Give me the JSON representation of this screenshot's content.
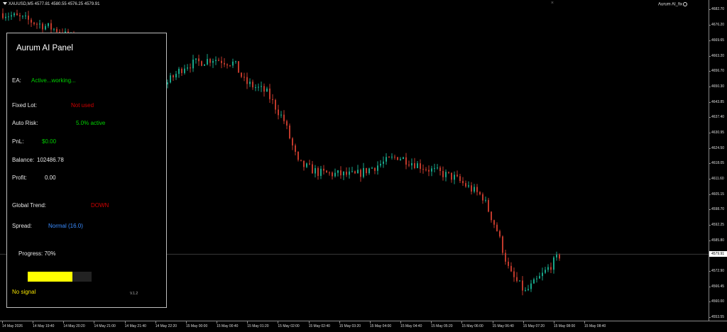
{
  "symbol_info": "XAUUSD,M5  4577.81 4580.55 4576.25 4579.91",
  "ea_name": "Aurum AI_fix",
  "close_glyph": "×",
  "colors": {
    "bull": "#17a589",
    "bear": "#c0392b",
    "accent_green": "#00d000",
    "accent_red": "#d00000",
    "accent_blue": "#3a8cff",
    "accent_yellow": "#ffff00"
  },
  "price_axis": {
    "labels": [
      "4682.70",
      "4676.20",
      "4669.65",
      "4663.20",
      "4656.70",
      "4650.30",
      "4643.85",
      "4637.40",
      "4630.95",
      "4624.50",
      "4618.05",
      "4611.60",
      "4605.15",
      "4598.70",
      "4592.25",
      "4585.80",
      "4572.90",
      "4566.45",
      "4560.00",
      "4553.55"
    ],
    "current_price": "4579.91",
    "range": [
      4553.55,
      4682.7
    ]
  },
  "time_axis": {
    "labels": [
      "14 May 2026",
      "14 May 19:40",
      "14 May 20:20",
      "14 May 21:00",
      "14 May 21:40",
      "14 May 22:20",
      "15 May 00:00",
      "15 May 00:40",
      "15 May 01:20",
      "15 May 02:00",
      "15 May 02:40",
      "15 May 03:20",
      "15 May 04:00",
      "15 May 04:40",
      "15 May 05:20",
      "15 May 06:00",
      "15 May 06:40",
      "15 May 07:20",
      "15 May 08:00",
      "15 May 08:40"
    ]
  },
  "panel": {
    "title": "Aurum AI Panel",
    "ea_label": "EA:",
    "ea_value": "Active...working...",
    "fixed_lot_label": "Fixed Lot:",
    "fixed_lot_value": "Not used",
    "auto_risk_label": "Auto Risk:",
    "auto_risk_value": "5.0% active",
    "pnl_label": "PnL:",
    "pnl_value": "$0.00",
    "balance_label": "Balance:",
    "balance_value": "102486.78",
    "profit_label": "Profit:",
    "profit_value": "0.00",
    "trend_label": "Global Trend:",
    "trend_value": "DOWN",
    "spread_label": "Spread:",
    "spread_value": "Normal (16.0)",
    "progress_text": "Progress: 70%",
    "progress_fraction": 0.7,
    "signal_text": "No signal",
    "version": "V.1.2"
  }
}
